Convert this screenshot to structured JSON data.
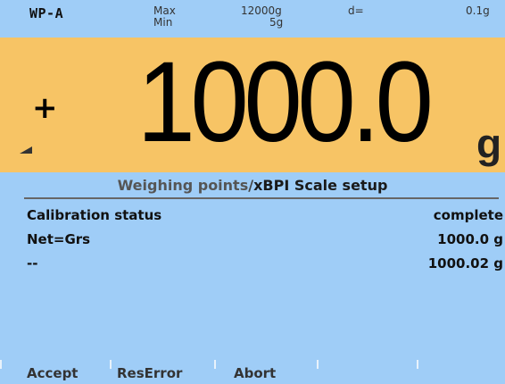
{
  "header": {
    "device": "WP-A",
    "max_label": "Max",
    "min_label": "Min",
    "max_value": "12000g",
    "min_value": "5g",
    "d_label": "d=",
    "d_value": "0.1g"
  },
  "display": {
    "sign": "+",
    "weight": "1000.0",
    "unit": "g"
  },
  "menu": {
    "title_main": "Weighing points",
    "title_sep": "/",
    "title_sub": "xBPI Scale setup",
    "rows": [
      {
        "label": "Calibration status",
        "value": "complete"
      },
      {
        "label": "Net=Grs",
        "value": "1000.0 g"
      },
      {
        "label": "--",
        "value": "1000.02 g"
      }
    ]
  },
  "softkeys": [
    "Accept",
    "ResError",
    "Abort",
    "",
    ""
  ]
}
